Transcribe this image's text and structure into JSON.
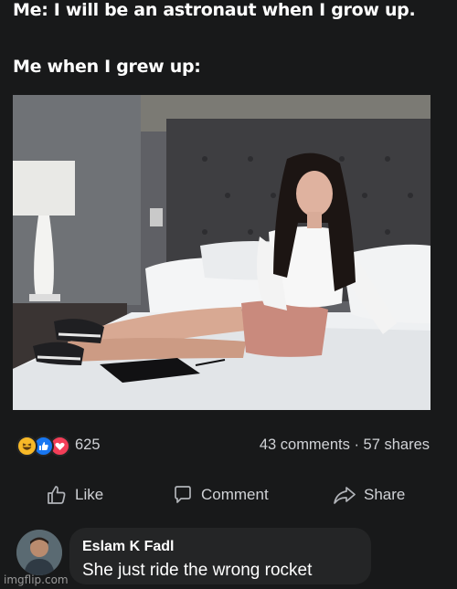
{
  "caption": {
    "line1": "Me: I will be an astronaut when I grow up.",
    "line2": "Me when I grew up:"
  },
  "photo": {
    "description_icon": "photo-image"
  },
  "post_stats": {
    "reaction_icons": [
      "haha-reaction-icon",
      "like-reaction-icon",
      "love-reaction-icon"
    ],
    "reaction_count": "625",
    "comments_shares": "43 comments · 57 shares"
  },
  "actions": {
    "like_label": "Like",
    "comment_label": "Comment",
    "share_label": "Share"
  },
  "comment": {
    "author": "Eslam K Fadl",
    "text": "She just ride the wrong rocket"
  },
  "watermark": "imgflip.com",
  "colors": {
    "background": "#18191a",
    "text": "#e4e6eb",
    "haha": "#f7b928",
    "like": "#1877f2",
    "love": "#f33e58"
  }
}
